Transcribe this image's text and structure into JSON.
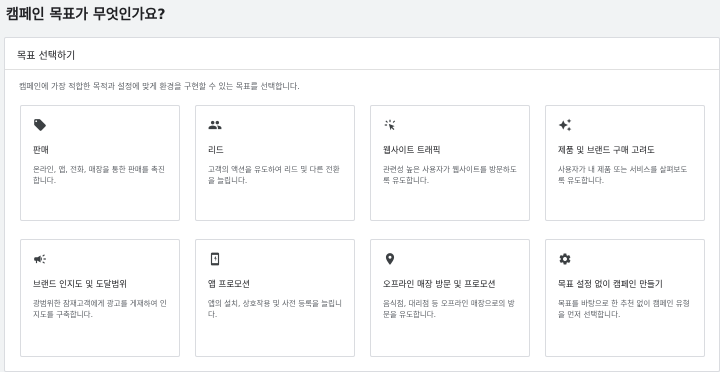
{
  "page": {
    "title": "캠페인 목표가 무엇인가요?"
  },
  "panel": {
    "header": "목표 선택하기",
    "description": "캠페인에 가장 적합한 목적과 설정에 맞게 환경을 구현할 수 있는 목표를 선택합니다."
  },
  "cards": [
    {
      "icon": "tag-icon",
      "title": "판매",
      "desc": "온라인, 앱, 전화, 매장을 통한 판매를 촉진합니다."
    },
    {
      "icon": "people-icon",
      "title": "리드",
      "desc": "고객의 액션을 유도하여 리드 및 다른 전환을 늘립니다."
    },
    {
      "icon": "click-icon",
      "title": "웹사이트 트래픽",
      "desc": "관련성 높은 사용자가 웹사이트를 방문하도록 유도합니다."
    },
    {
      "icon": "sparkle-icon",
      "title": "제품 및 브랜드 구매 고려도",
      "desc": "사용자가 내 제품 또는 서비스를 살펴보도록 유도합니다."
    },
    {
      "icon": "megaphone-icon",
      "title": "브랜드 인지도 및 도달범위",
      "desc": "광범위한 잠재고객에게 광고를 게재하여 인지도를 구축합니다."
    },
    {
      "icon": "phone-icon",
      "title": "앱 프로모션",
      "desc": "앱의 설치, 상호작용 및 사전 등록을 늘립니다."
    },
    {
      "icon": "location-pin-icon",
      "title": "오프라인 매장 방문 및 프로모션",
      "desc": "음식점, 대리점 등 오프라인 매장으로의 방문을 유도합니다."
    },
    {
      "icon": "gear-icon",
      "title": "목표 설정 없이 캠페인 만들기",
      "desc": "목표를 바탕으로 한 추천 없이 캠페인 유형을 먼저 선택합니다."
    }
  ]
}
